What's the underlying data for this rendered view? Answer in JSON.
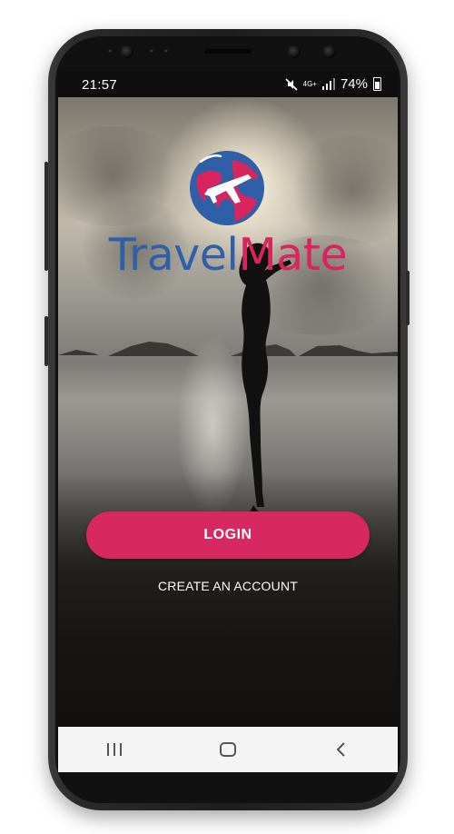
{
  "status_bar": {
    "time": "21:57",
    "network": "4G+",
    "battery_percent": "74%",
    "mute_icon": "mute-icon",
    "signal_icon": "signal-bars-icon",
    "battery_icon": "battery-icon"
  },
  "logo": {
    "word_1": "Travel",
    "word_2": "Mate",
    "globe_icon": "globe-airplane-icon",
    "colors": {
      "blue": "#2f5fa6",
      "pink": "#d9255e"
    }
  },
  "actions": {
    "login_label": "LOGIN",
    "create_account_label": "CREATE AN ACCOUNT"
  },
  "nav_bar": {
    "recents_icon": "recents-icon",
    "home_icon": "home-icon",
    "back_icon": "back-icon"
  },
  "theme": {
    "accent": "#d72862",
    "nav_background": "#f4f4f4"
  }
}
